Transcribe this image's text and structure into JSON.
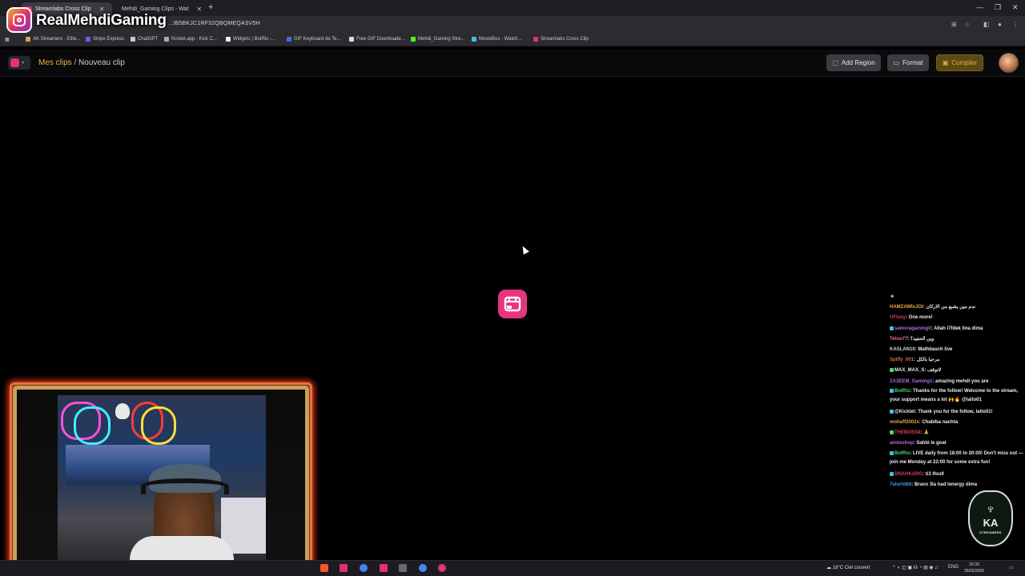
{
  "browser": {
    "tabs": [
      {
        "title": "Streamlabs Cross Clip",
        "active": true
      },
      {
        "title": "Mehdi_Gaming Clips - Wat"
      }
    ],
    "url": "...IB5BKJC1RF32QBQMEQASV5H",
    "bookmarks": [
      "AK Streamers - Elite...",
      "Stripe Express",
      "ChatGPT",
      "Kicklet.app - Kick C...",
      "Widgets | BotRix -...",
      "GIF Keyboard de Te...",
      "Free GIF Downloade...",
      "Mehdi_Gaming Stre...",
      "MovieBox - Watch...",
      "Streamlabs Cross Clip"
    ]
  },
  "overlay": {
    "channel_name": "RealMehdiGaming"
  },
  "app": {
    "breadcrumb": {
      "parent": "Mes clips",
      "separator": " / ",
      "current": "Nouveau clip"
    },
    "buttons": {
      "add_region": "Add Region",
      "format": "Format",
      "compile": "Compiler"
    },
    "colors": {
      "accent_pink": "#e6357f",
      "breadcrumb_gold": "#e3b93c"
    }
  },
  "chat": {
    "messages": [
      {
        "user": "HAMZAWIxJOI",
        "color": "#e8a64a",
        "text": ": ندم مين يشبع من الاركان"
      },
      {
        "user": "UFlusy",
        "color": "#e03b5c",
        "text": ": One more!"
      },
      {
        "user": "samvragaming0",
        "color": "#b46ad8",
        "text": ": Allah i7fdek lina dima"
      },
      {
        "user": "TeloaYT",
        "color": "#e8708a",
        "text": ": وين الحفيد؟"
      },
      {
        "user": "KASLAN10",
        "color": "#d8d8d8",
        "text": ": Mathbasch live"
      },
      {
        "user": "Spiffy_001",
        "color": "#e06a4a",
        "text": ": مرحبا بالكل"
      },
      {
        "user": "MAX_MAX_S",
        "color": "#e8e8e8",
        "text": ": لاتوقف"
      },
      {
        "user": "ZA3EEM_Gaming1",
        "color": "#b46ad8",
        "text": ": amazing mehdi you are"
      },
      {
        "user": "BotRix",
        "color": "#4cd964",
        "text": ": Thanks for the follow! Welcome to the stream, your support means a lot 🙌🔥 @laito01"
      },
      {
        "user": "@Kicklet",
        "color": "#e8e8e8",
        "text": ": Thank you for the follow, laito01!"
      },
      {
        "user": "mohaff2002x",
        "color": "#e8a64a",
        "text": ": Chabiba nachta"
      },
      {
        "user": "THEBOSS8",
        "color": "#e03b5c",
        "text": ": 🙏"
      },
      {
        "user": "aintwshop",
        "color": "#b46ad8",
        "text": ": Sahbi le goat"
      },
      {
        "user": "BotRix",
        "color": "#4cd964",
        "text": ": LIVE daily from 18:00 to 20:00! Don't miss out — join me Monday at 22:00 for some extra fun!"
      },
      {
        "user": "DNAHKARG",
        "color": "#e03b5c",
        "text": ": ti3 lfou9"
      },
      {
        "user": "7alwrld68",
        "color": "#4a90e2",
        "text": ": Bravo 3la had lenergy dima"
      }
    ]
  },
  "emblem": {
    "letters": "KA",
    "tag": "STREAMERS"
  },
  "taskbar": {
    "weather": "18°C  Ciel couvert",
    "lang": "ENG",
    "time": "20:33",
    "date": "25/02/2026"
  }
}
